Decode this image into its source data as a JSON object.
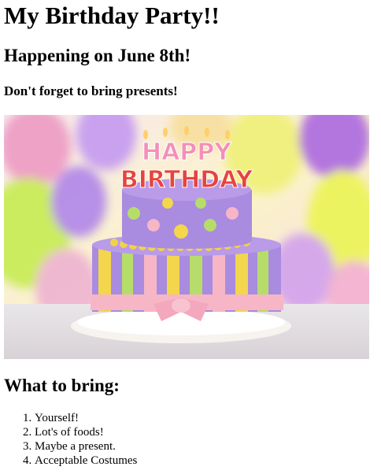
{
  "page": {
    "title": "My Birthday Party!!",
    "subtitle": "Happening on June 8th!",
    "note": "Don't forget to bring presents!"
  },
  "image": {
    "description": "Birthday cake with HAPPY BIRTHDAY candles in front of colorful balloons",
    "candle_text_line1": "HAPPY",
    "candle_text_line2": "BIRTHDAY",
    "colors": {
      "cake_purple": "#a98be0",
      "cake_yellow": "#f3d64b",
      "cake_green": "#b6dd6a",
      "cake_pink": "#f6b6c6"
    }
  },
  "bring": {
    "heading": "What to bring:",
    "items": [
      "Yourself!",
      "Lot's of foods!",
      "Maybe a present.",
      "Acceptable Costumes"
    ]
  }
}
